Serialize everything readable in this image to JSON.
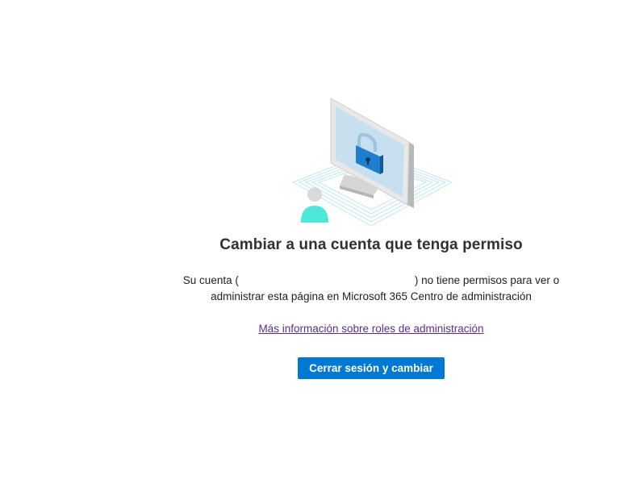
{
  "illustration": {
    "icon": "locked-computer-icon",
    "accent": "#0078d4",
    "user_color": "#4ee8d8"
  },
  "title": "Cambiar a una cuenta que tenga permiso",
  "description": {
    "prefix": "Su cuenta (",
    "suffix": ") no tiene permisos para ver o administrar esta página en Microsoft 365 Centro de administración"
  },
  "link_text": "Más información sobre roles de administración",
  "button_label": "Cerrar sesión y cambiar",
  "colors": {
    "button": "#0078d4",
    "link": "#5c2d91",
    "title": "#323130"
  }
}
